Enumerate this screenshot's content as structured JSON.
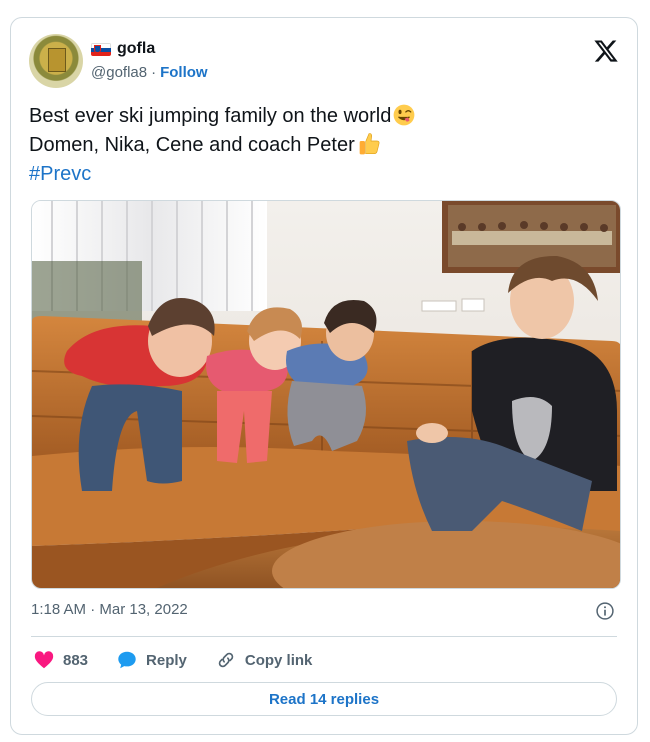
{
  "author": {
    "display_name": "gofla",
    "handle": "@gofla8",
    "separator": "·",
    "follow_label": "Follow",
    "flag_icon": "slovenia-flag-icon"
  },
  "tweet": {
    "line1": "Best ever ski jumping family on the world",
    "line2": "Domen, Nika, Cene and coach Peter",
    "hashtag": "#Prevc",
    "emoji1": "winking-face-tongue-emoji",
    "emoji2": "thumbs-up-emoji"
  },
  "photo": {
    "subject": "four children on a brown leather sofa"
  },
  "meta": {
    "timestamp": "1:18 AM · Mar 13, 2022"
  },
  "actions": {
    "like_count": "883",
    "reply_label": "Reply",
    "copy_link_label": "Copy link"
  },
  "read_replies_label": "Read 14 replies",
  "colors": {
    "accent": "#1d74c8",
    "like": "#f91880",
    "reply_icon": "#1d9bf0",
    "border": "#cfd9de",
    "muted": "#536471"
  }
}
